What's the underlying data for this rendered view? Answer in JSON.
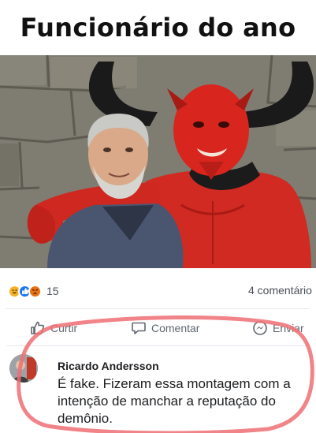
{
  "meme": {
    "title": "Funcionário do ano"
  },
  "reactions": {
    "icons": [
      "haha-icon",
      "like-icon",
      "angry-icon"
    ],
    "count": "15"
  },
  "comments_count": "4 comentário",
  "actions": {
    "like_label": "Curtir",
    "comment_label": "Comentar",
    "share_label": "Enviar"
  },
  "comment": {
    "author": "Ricardo Andersson",
    "text": "É fake. Fizeram essa montagem com a intenção de manchar a reputação do demônio."
  },
  "colors": {
    "highlight": "#ef6f74",
    "like_blue": "#1877f2",
    "haha_yellow": "#f7b125",
    "angry_orange": "#e9710f",
    "devil_red": "#d8261f"
  }
}
